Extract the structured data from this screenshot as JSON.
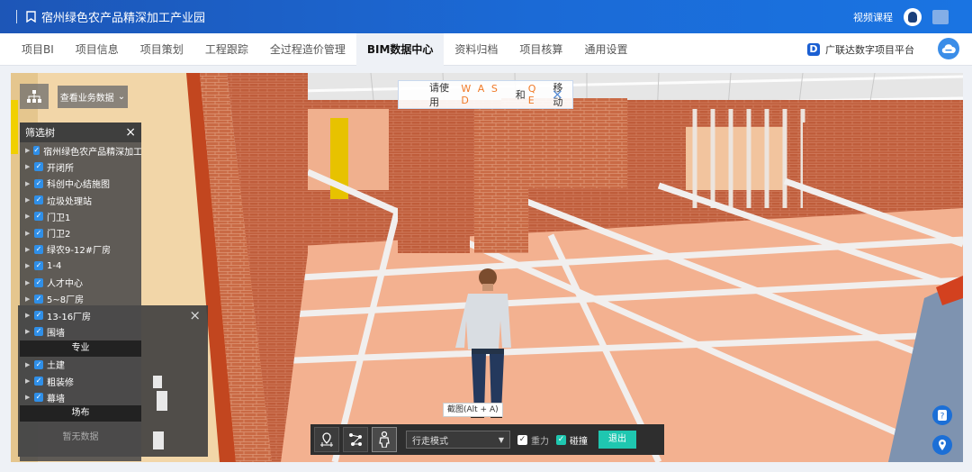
{
  "header": {
    "title": "宿州绿色农产品精深加工产业园",
    "video_course": "视频课程",
    "account_icon": "user-avatar-icon"
  },
  "nav": {
    "tabs": [
      "项目BI",
      "项目信息",
      "项目策划",
      "工程跟踪",
      "全过程造价管理",
      "BIM数据中心",
      "资料归档",
      "项目核算",
      "通用设置"
    ],
    "active_tab": "BIM数据中心",
    "platform_icon_letter": "D",
    "platform_label": "广联达数字项目平台"
  },
  "viewer": {
    "hint_prefix": "请使用",
    "hint_keys_1": "W A S D",
    "hint_mid": "和",
    "hint_keys_2": "Q E",
    "hint_suffix": "移动",
    "biz_data_label": "查看业务数据",
    "screenshot_tooltip": "截图(Alt + A)",
    "walk_mode": "行走模式",
    "gravity_label": "重力",
    "collision_label": "碰撞",
    "exit_label": "退出"
  },
  "filter_tree": {
    "title": "筛选树",
    "items": [
      "宿州绿色农产品精深加工",
      "开闭所",
      "科创中心结施图",
      "垃圾处理站",
      "门卫1",
      "门卫2",
      "绿农9-12#厂房",
      "1-4",
      "人才中心",
      "5~8厂房",
      "13-16厂房",
      "围墙"
    ],
    "section_discipline": "专业",
    "discipline_items": [
      "土建",
      "粗装修",
      "幕墙"
    ],
    "section_site": "场布",
    "empty_text": "暂无数据"
  },
  "colors": {
    "header_blue": "#1b5fc8",
    "accent_teal": "#1fc7b0",
    "checkbox_blue": "#2f8fe8",
    "hint_orange": "#f07a27"
  }
}
